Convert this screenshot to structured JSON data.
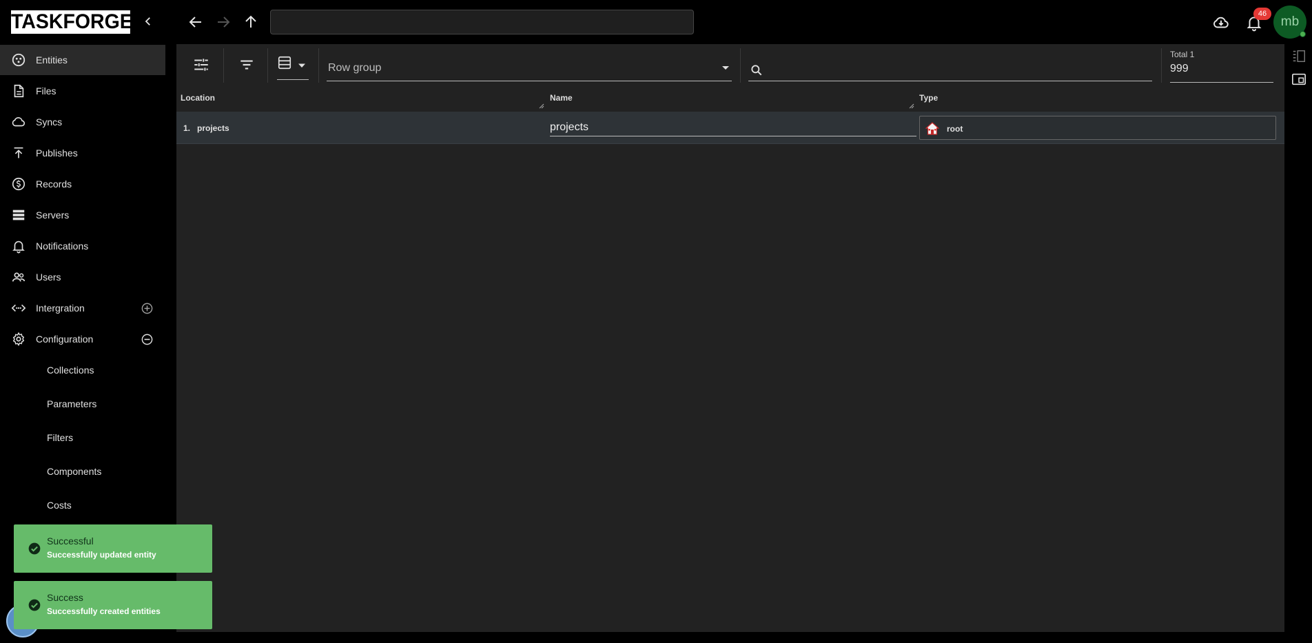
{
  "app": {
    "logo_text": "TASKFORGER"
  },
  "topbar": {
    "path_value": "",
    "notifications_count": "46",
    "avatar_initials": "mb",
    "icons": [
      "chevron-left-icon",
      "arrow-back-icon",
      "arrow-forward-icon",
      "arrow-up-icon",
      "cloud-download-icon",
      "bell-icon"
    ]
  },
  "sidebar": {
    "items": [
      {
        "label": "Entities",
        "icon": "entities-icon",
        "active": true
      },
      {
        "label": "Files",
        "icon": "file-icon"
      },
      {
        "label": "Syncs",
        "icon": "cloud-sync-icon"
      },
      {
        "label": "Publishes",
        "icon": "publish-icon"
      },
      {
        "label": "Records",
        "icon": "dollar-icon"
      },
      {
        "label": "Servers",
        "icon": "servers-icon"
      },
      {
        "label": "Notifications",
        "icon": "bell-icon"
      },
      {
        "label": "Users",
        "icon": "users-icon"
      },
      {
        "label": "Intergration",
        "icon": "integration-icon",
        "trail": "add-circle-icon"
      },
      {
        "label": "Configuration",
        "icon": "gear-icon",
        "trail": "remove-circle-icon"
      }
    ],
    "sub_items": [
      "Collections",
      "Parameters",
      "Filters",
      "Components",
      "Costs"
    ]
  },
  "toolbar": {
    "row_group_label": "Row group",
    "search_value": "",
    "total_caption": "Total 1",
    "total_value": "999"
  },
  "grid": {
    "columns": [
      "Location",
      "Name",
      "Type"
    ],
    "rows": [
      {
        "index": "1.",
        "location": "projects",
        "name": "projects",
        "type": "root"
      }
    ]
  },
  "toasts": [
    {
      "title": "Successful",
      "message": "Successfully updated entity"
    },
    {
      "title": "Success",
      "message": "Successfully created entities"
    }
  ],
  "colors": {
    "toast_bg": "#66bb6a",
    "badge": "#e53935",
    "avatar_bg": "#0d5b24",
    "active_item": "#2a2a2a",
    "panel_bg": "#222222"
  }
}
